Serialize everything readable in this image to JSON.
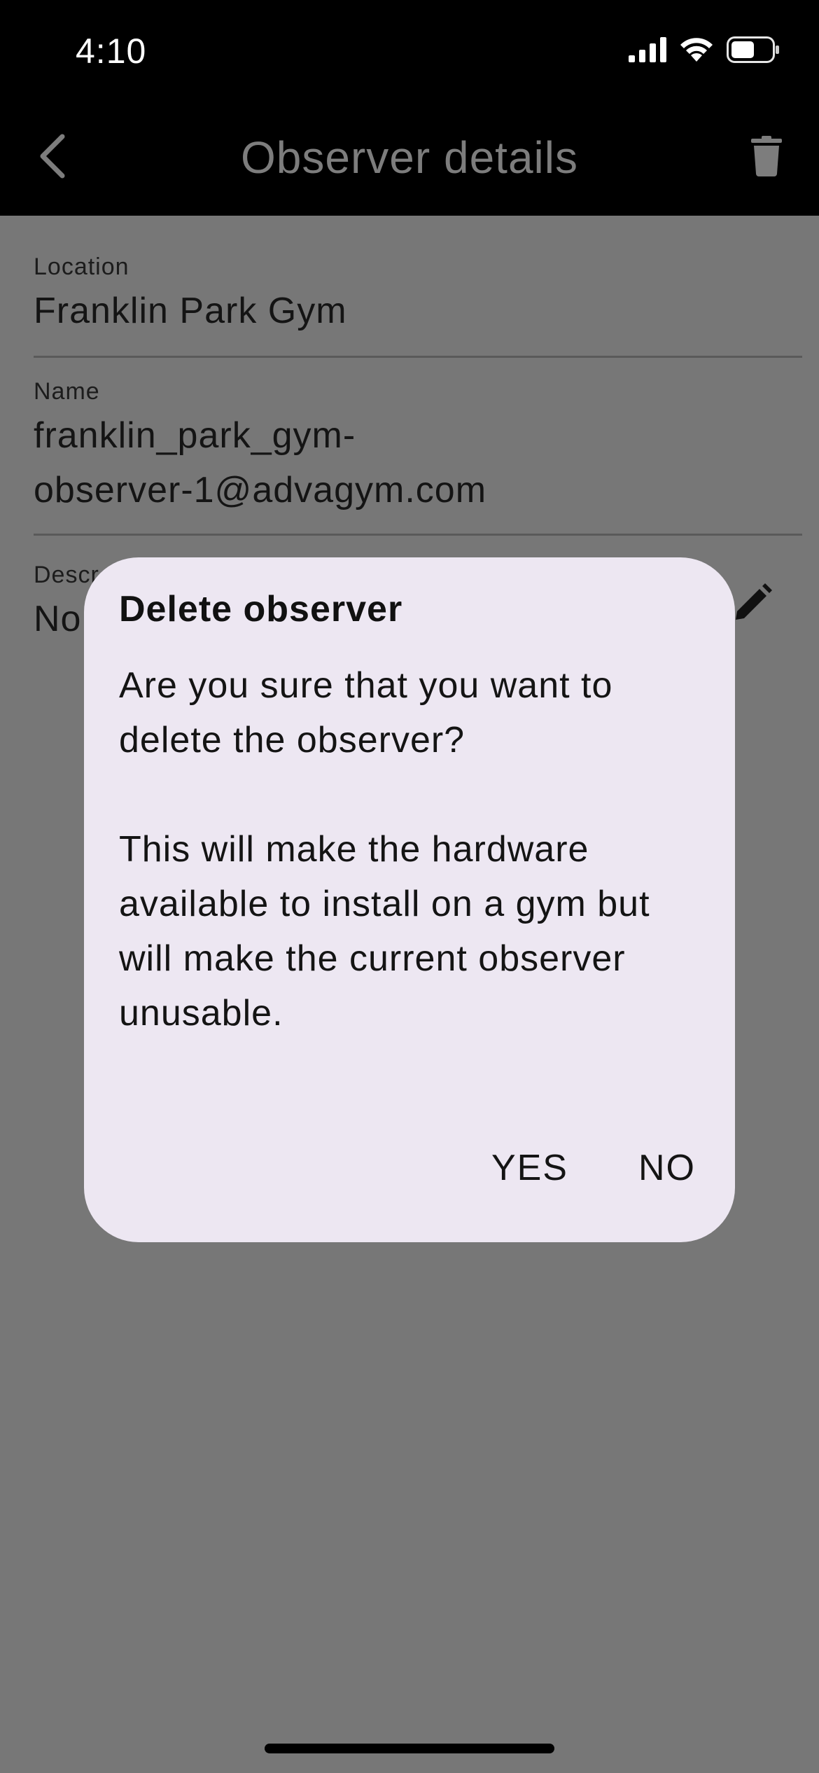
{
  "status_bar": {
    "time": "4:10",
    "icons": [
      "signal-icon",
      "wifi-icon",
      "battery-icon"
    ]
  },
  "app_bar": {
    "title": "Observer details",
    "back_icon": "chevron-left-icon",
    "action_icon": "trash-icon"
  },
  "fields": {
    "location": {
      "label": "Location",
      "value": "Franklin Park Gym"
    },
    "name": {
      "label": "Name",
      "value_line1": "franklin_park_gym-",
      "value_line2": "observer-1@advagym.com"
    },
    "description": {
      "label": "Descr",
      "value": "No",
      "edit_icon": "pencil-icon"
    }
  },
  "dialog": {
    "title": "Delete observer",
    "paragraph1": "Are you sure that you want to delete the observer?",
    "paragraph2": "This will make the hardware available to install on a gym but will make the current observer unusable.",
    "yes_label": "YES",
    "no_label": "NO"
  },
  "colors": {
    "scrim": "#777777",
    "app_bar": "#000000",
    "dialog_bg": "#ede7f2",
    "title_text": "#7d7d7d"
  }
}
